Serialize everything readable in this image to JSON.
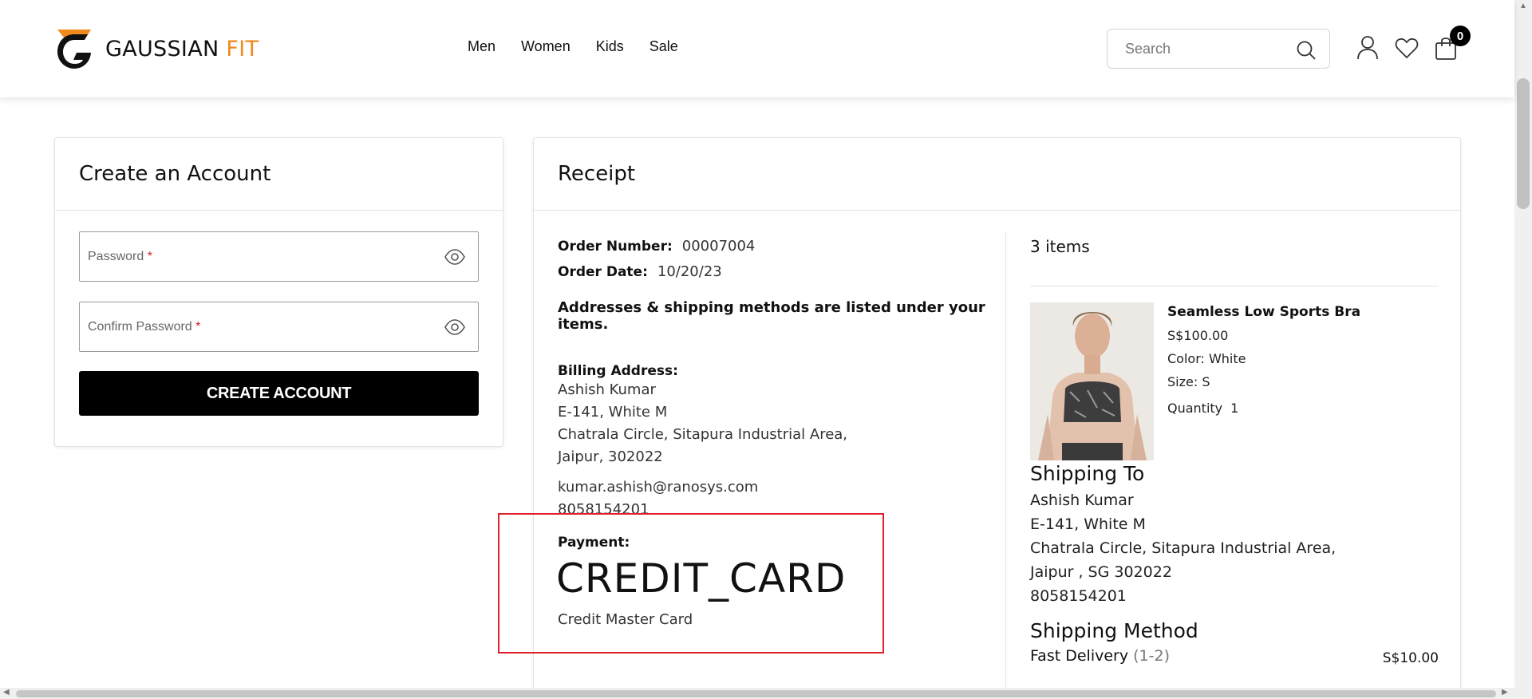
{
  "brand": {
    "name_part1": "GAUSSIAN",
    "name_part2": "FIT",
    "accent": "#f08a1c"
  },
  "nav": {
    "items": [
      "Men",
      "Women",
      "Kids",
      "Sale"
    ]
  },
  "search": {
    "placeholder": "Search",
    "value": ""
  },
  "header_icons": [
    "user-icon",
    "heart-icon",
    "cart-icon"
  ],
  "cart": {
    "count": "0"
  },
  "create_account": {
    "title": "Create an Account",
    "password_label": "Password",
    "confirm_label": "Confirm Password",
    "required_mark": "*",
    "button_label": "CREATE ACCOUNT"
  },
  "receipt": {
    "title": "Receipt",
    "order_number_label": "Order Number:",
    "order_number": "00007004",
    "order_date_label": "Order Date:",
    "order_date": "10/20/23",
    "note": "Addresses & shipping methods are listed under your items.",
    "billing": {
      "label": "Billing Address:",
      "name": "Ashish Kumar",
      "line1": "E-141, White M",
      "line2": "Chatrala Circle, Sitapura Industrial Area,",
      "line3": "Jaipur, 302022",
      "email": "kumar.ashish@ranosys.com",
      "phone": "8058154201"
    },
    "payment": {
      "label": "Payment:",
      "type": "CREDIT_CARD",
      "detail": "Credit Master Card"
    },
    "items_count": "3 items",
    "product": {
      "name": "Seamless Low Sports Bra",
      "price": "S$100.00",
      "color": "Color: White",
      "size": "Size: S",
      "quantity_label": "Quantity",
      "quantity": "1"
    },
    "shipping_to": {
      "title": "Shipping To",
      "name": "Ashish Kumar",
      "line1": "E-141, White M",
      "line2": "Chatrala Circle, Sitapura Industrial Area,",
      "line3": "Jaipur , SG 302022",
      "phone": "8058154201"
    },
    "shipping_method": {
      "title": "Shipping Method",
      "name": "Fast Delivery",
      "eta": "(1-2)",
      "price": "S$10.00"
    }
  },
  "colors": {
    "highlight_border": "#e0202a",
    "button_bg": "#000000",
    "required": "#d21f1f"
  }
}
